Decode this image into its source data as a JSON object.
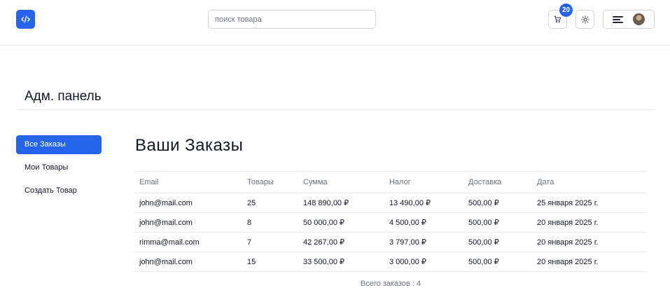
{
  "header": {
    "search_placeholder": "поиск товара",
    "cart_count": "20"
  },
  "page_title": "Адм. панель",
  "sidebar": {
    "items": [
      {
        "label": "Все Заказы",
        "active": true
      },
      {
        "label": "Мои Товары",
        "active": false
      },
      {
        "label": "Создать Товар",
        "active": false
      }
    ]
  },
  "orders": {
    "title": "Ваши Заказы",
    "columns": [
      "Email",
      "Товары",
      "Сумма",
      "Налог",
      "Доставка",
      "Дата"
    ],
    "rows": [
      [
        "john@mail.com",
        "25",
        "148 890,00 ₽",
        "13 490,00 ₽",
        "500,00 ₽",
        "25 января 2025 г."
      ],
      [
        "john@mail.com",
        "8",
        "50 000,00 ₽",
        "4 500,00 ₽",
        "500,00 ₽",
        "20 января 2025 г."
      ],
      [
        "rimma@mail.com",
        "7",
        "42 267,00 ₽",
        "3 797,00 ₽",
        "500,00 ₽",
        "20 января 2025 г."
      ],
      [
        "john@mail.com",
        "15",
        "33 500,00 ₽",
        "3 000,00 ₽",
        "500,00 ₽",
        "20 января 2025 г."
      ]
    ],
    "total_label": "Всего заказов : 4"
  },
  "colors": {
    "accent": "#2563eb",
    "border": "#e5e7eb",
    "muted_text": "#6b7280"
  },
  "icons": [
    "code-logo-icon",
    "cart-icon",
    "sun-icon",
    "hamburger-icon",
    "avatar"
  ]
}
